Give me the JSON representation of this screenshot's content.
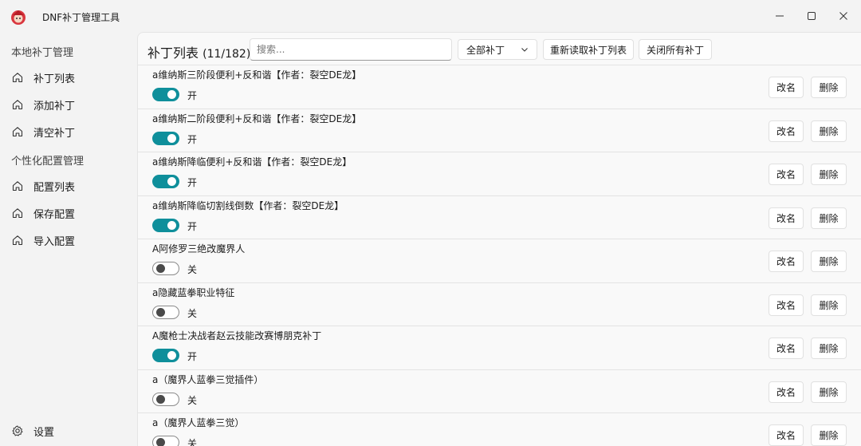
{
  "app": {
    "title": "DNF补丁管理工具",
    "colors": {
      "accent": "#0f8f9b",
      "background": "#f3f3f3",
      "panel": "#f9f9f9"
    }
  },
  "window_controls": {
    "minimize": "—",
    "maximize": "☐",
    "close": "✕"
  },
  "sidebar": {
    "section_local": "本地补丁管理",
    "items_local": [
      {
        "label": "补丁列表",
        "icon": "home-icon"
      },
      {
        "label": "添加补丁",
        "icon": "home-icon"
      },
      {
        "label": "清空补丁",
        "icon": "home-icon"
      }
    ],
    "section_config": "个性化配置管理",
    "items_config": [
      {
        "label": "配置列表",
        "icon": "home-icon"
      },
      {
        "label": "保存配置",
        "icon": "home-icon"
      },
      {
        "label": "导入配置",
        "icon": "home-icon"
      }
    ],
    "settings": {
      "label": "设置",
      "icon": "gear-icon"
    }
  },
  "toolbar": {
    "title": "补丁列表",
    "count": "(11/182)",
    "search_placeholder": "搜索...",
    "filter_selected": "全部补丁",
    "reload_label": "重新读取补丁列表",
    "close_all_label": "关闭所有补丁"
  },
  "patches": [
    {
      "name": "a维纳斯三阶段便利+反和谐【作者：裂空DE龙】",
      "enabled": true,
      "state_label": "开"
    },
    {
      "name": "a维纳斯二阶段便利+反和谐【作者：裂空DE龙】",
      "enabled": true,
      "state_label": "开"
    },
    {
      "name": "a维纳斯降临便利+反和谐【作者：裂空DE龙】",
      "enabled": true,
      "state_label": "开"
    },
    {
      "name": "a维纳斯降临切割线倒数【作者：裂空DE龙】",
      "enabled": true,
      "state_label": "开"
    },
    {
      "name": "A阿修罗三绝改魔界人",
      "enabled": false,
      "state_label": "关"
    },
    {
      "name": "a隐藏蓝拳职业特征",
      "enabled": false,
      "state_label": "关"
    },
    {
      "name": "A魔枪士决战者赵云技能改赛博朋克补丁",
      "enabled": true,
      "state_label": "开"
    },
    {
      "name": "a（魔界人蓝拳三觉插件）",
      "enabled": false,
      "state_label": "关"
    },
    {
      "name": "a（魔界人蓝拳三觉）",
      "enabled": false,
      "state_label": "关"
    }
  ],
  "row_actions": {
    "rename_label": "改名",
    "delete_label": "删除"
  }
}
